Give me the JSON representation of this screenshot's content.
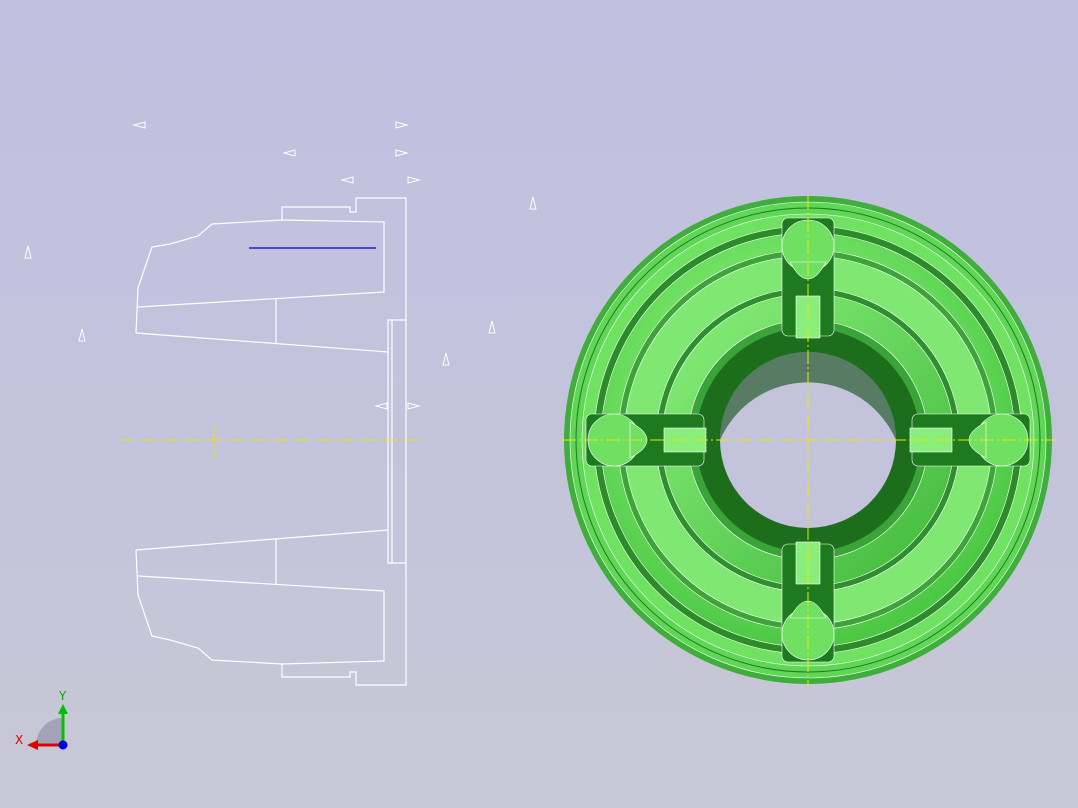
{
  "viewport": {
    "background_top": "#c0c0e0",
    "background_bottom": "#c8c8d4"
  },
  "colors": {
    "outline": "#ffffff",
    "centerline": "#e8e800",
    "highlight_edge": "#0000cc",
    "part_fill": "#66e066",
    "part_light": "#99f099",
    "part_dark": "#1c8c1c",
    "axis_x": "#e00000",
    "axis_y": "#00c000",
    "axis_z": "#0000e0"
  },
  "part": {
    "material_icon": "green-shaded-solid"
  },
  "triad": {
    "x_label": "X",
    "y_label": "Y"
  }
}
